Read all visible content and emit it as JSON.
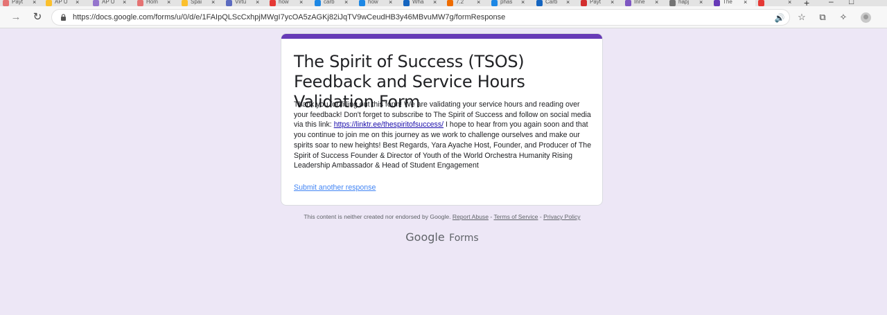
{
  "browser": {
    "tabs": [
      {
        "label": "Payt",
        "color": "#e57373"
      },
      {
        "label": "AP U",
        "color": "#fbc02d"
      },
      {
        "label": "AP U",
        "color": "#9575cd"
      },
      {
        "label": "Hom",
        "color": "#e57373"
      },
      {
        "label": "Spai",
        "color": "#fbc02d"
      },
      {
        "label": "Virtu",
        "color": "#5c6bc0"
      },
      {
        "label": "how",
        "color": "#e53935"
      },
      {
        "label": "carb",
        "color": "#1e88e5"
      },
      {
        "label": "how",
        "color": "#1e88e5"
      },
      {
        "label": "Wha",
        "color": "#1565c0"
      },
      {
        "label": "7.2",
        "color": "#ef6c00"
      },
      {
        "label": "phas",
        "color": "#1e88e5"
      },
      {
        "label": "Carb",
        "color": "#1565c0"
      },
      {
        "label": "Payt",
        "color": "#d32f2f"
      },
      {
        "label": "Inne",
        "color": "#7e57c2"
      },
      {
        "label": "hapj",
        "color": "#757575"
      },
      {
        "label": "The",
        "color": "#673ab7"
      },
      {
        "label": "",
        "color": "#e53935"
      }
    ],
    "new_tab": "+",
    "url": "https://docs.google.com/forms/u/0/d/e/1FAIpQLScCxhpjMWgI7ycOA5zAGKj82iJqTV9wCeudHB3y46MBvuMW7g/formResponse"
  },
  "form": {
    "title": "The Spirit of Success (TSOS) Feedback and Service Hours Validation Form",
    "message_before": "Thank you for filling out this form! We are validating your service hours and reading over your feedback! Don't forget to subscribe to The Spirit of Success and follow on social media via this link: ",
    "link": "https://linktr.ee/thespiritofsuccess/",
    "message_after": " I hope to hear from you again soon and that you continue to join me on this journey as we work to challenge ourselves and make our spirits soar to new heights!   Best Regards,   Yara Ayache  Host, Founder, and Producer of The Spirit of Success Founder & Director of Youth of the World Orchestra Humanity Rising Leadership Ambassador & Head of Student Engagement",
    "submit_another": "Submit another response"
  },
  "footer": {
    "disclaimer": "This content is neither created nor endorsed by Google.",
    "report_abuse": "Report Abuse",
    "terms": "Terms of Service",
    "privacy": "Privacy Policy",
    "brand_google": "Google",
    "brand_forms": "Forms"
  },
  "colors": {
    "accent": "#673ab7",
    "background": "#ede7f6",
    "link": "#1a0dab"
  }
}
